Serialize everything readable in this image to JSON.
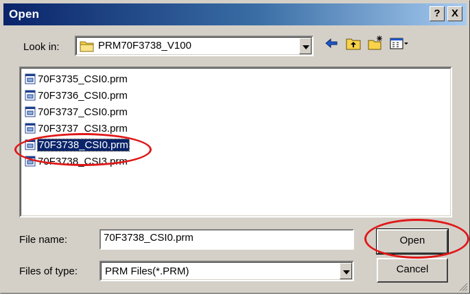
{
  "window": {
    "title": "Open"
  },
  "titlebar": {
    "help_label": "?",
    "close_label": "X"
  },
  "lookin": {
    "label": "Look in:",
    "value": "PRM70F3738_V100"
  },
  "files": [
    {
      "name": "70F3735_CSI0.prm"
    },
    {
      "name": "70F3736_CSI0.prm"
    },
    {
      "name": "70F3737_CSI0.prm"
    },
    {
      "name": "70F3737_CSI3.prm"
    },
    {
      "name": "70F3738_CSI0.prm"
    },
    {
      "name": "70F3738_CSI3.prm"
    }
  ],
  "selected_index": 4,
  "filename": {
    "label": "File name:",
    "value": "70F3738_CSI0.prm"
  },
  "filetype": {
    "label": "Files of type:",
    "value": "PRM Files(*.PRM)"
  },
  "buttons": {
    "open": "Open",
    "cancel": "Cancel"
  },
  "icons": {
    "folder": "folder-icon",
    "back": "back-arrow-icon",
    "up": "up-folder-icon",
    "newfolder": "new-folder-icon",
    "view": "view-menu-icon",
    "file": "prm-file-icon"
  },
  "colors": {
    "title_start": "#0a246a",
    "title_end": "#a6caf0",
    "selection": "#0a246a",
    "highlight_ring": "#e01818"
  }
}
